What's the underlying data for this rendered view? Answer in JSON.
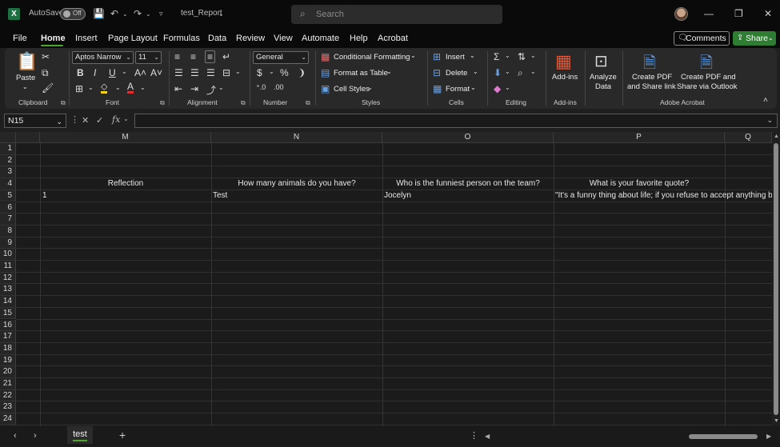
{
  "titlebar": {
    "autosave_label": "AutoSave",
    "autosave_state": "Off",
    "doc_title": "test_Report",
    "search_placeholder": "Search"
  },
  "menu": {
    "items": [
      "File",
      "Home",
      "Insert",
      "Page Layout",
      "Formulas",
      "Data",
      "Review",
      "View",
      "Automate",
      "Help",
      "Acrobat"
    ],
    "active": "Home",
    "comments_label": "Comments",
    "share_label": "Share"
  },
  "ribbon": {
    "clipboard": {
      "paste": "Paste",
      "label": "Clipboard"
    },
    "font": {
      "name": "Aptos Narrow",
      "size": "11",
      "label": "Font"
    },
    "alignment": {
      "label": "Alignment"
    },
    "number": {
      "format": "General",
      "label": "Number"
    },
    "styles": {
      "conditional": "Conditional Formatting",
      "table": "Format as Table",
      "cell_styles": "Cell Styles",
      "label": "Styles"
    },
    "cells": {
      "insert": "Insert",
      "delete": "Delete",
      "format": "Format",
      "label": "Cells"
    },
    "editing": {
      "label": "Editing"
    },
    "addins": {
      "button": "Add-ins",
      "label": "Add-ins"
    },
    "analyze": {
      "line1": "Analyze",
      "line2": "Data"
    },
    "acrobat": {
      "pdf_link_1": "Create PDF",
      "pdf_link_2": "and Share link",
      "pdf_outlook_1": "Create PDF and",
      "pdf_outlook_2": "Share via Outlook",
      "label": "Adobe Acrobat"
    }
  },
  "formula_bar": {
    "name_box": "N15",
    "fx": "fx",
    "content": ""
  },
  "sheet": {
    "columns": [
      "M",
      "N",
      "O",
      "P",
      "Q"
    ],
    "rows": [
      "1",
      "2",
      "3",
      "4",
      "5",
      "6",
      "7",
      "8",
      "9",
      "10",
      "11",
      "12",
      "13",
      "14",
      "15",
      "16",
      "17",
      "18",
      "19",
      "20",
      "21",
      "22",
      "23",
      "24"
    ],
    "headers_row4": {
      "M": "Reflection",
      "N": "How many animals do you have?",
      "O": "Who is the funniest person on the team?",
      "P": "What is your favorite quote?"
    },
    "data_row5": {
      "M": "1",
      "N": "Test",
      "O": "Jocelyn",
      "P": "\"It's a funny thing about life; if you refuse to accept anything but the best, you very often get it.\""
    }
  },
  "tabs": {
    "sheets": [
      "test"
    ],
    "active": "test"
  },
  "colors": {
    "accent": "#4ea72e",
    "share": "#2e7d32",
    "background": "#1f1f1f"
  }
}
